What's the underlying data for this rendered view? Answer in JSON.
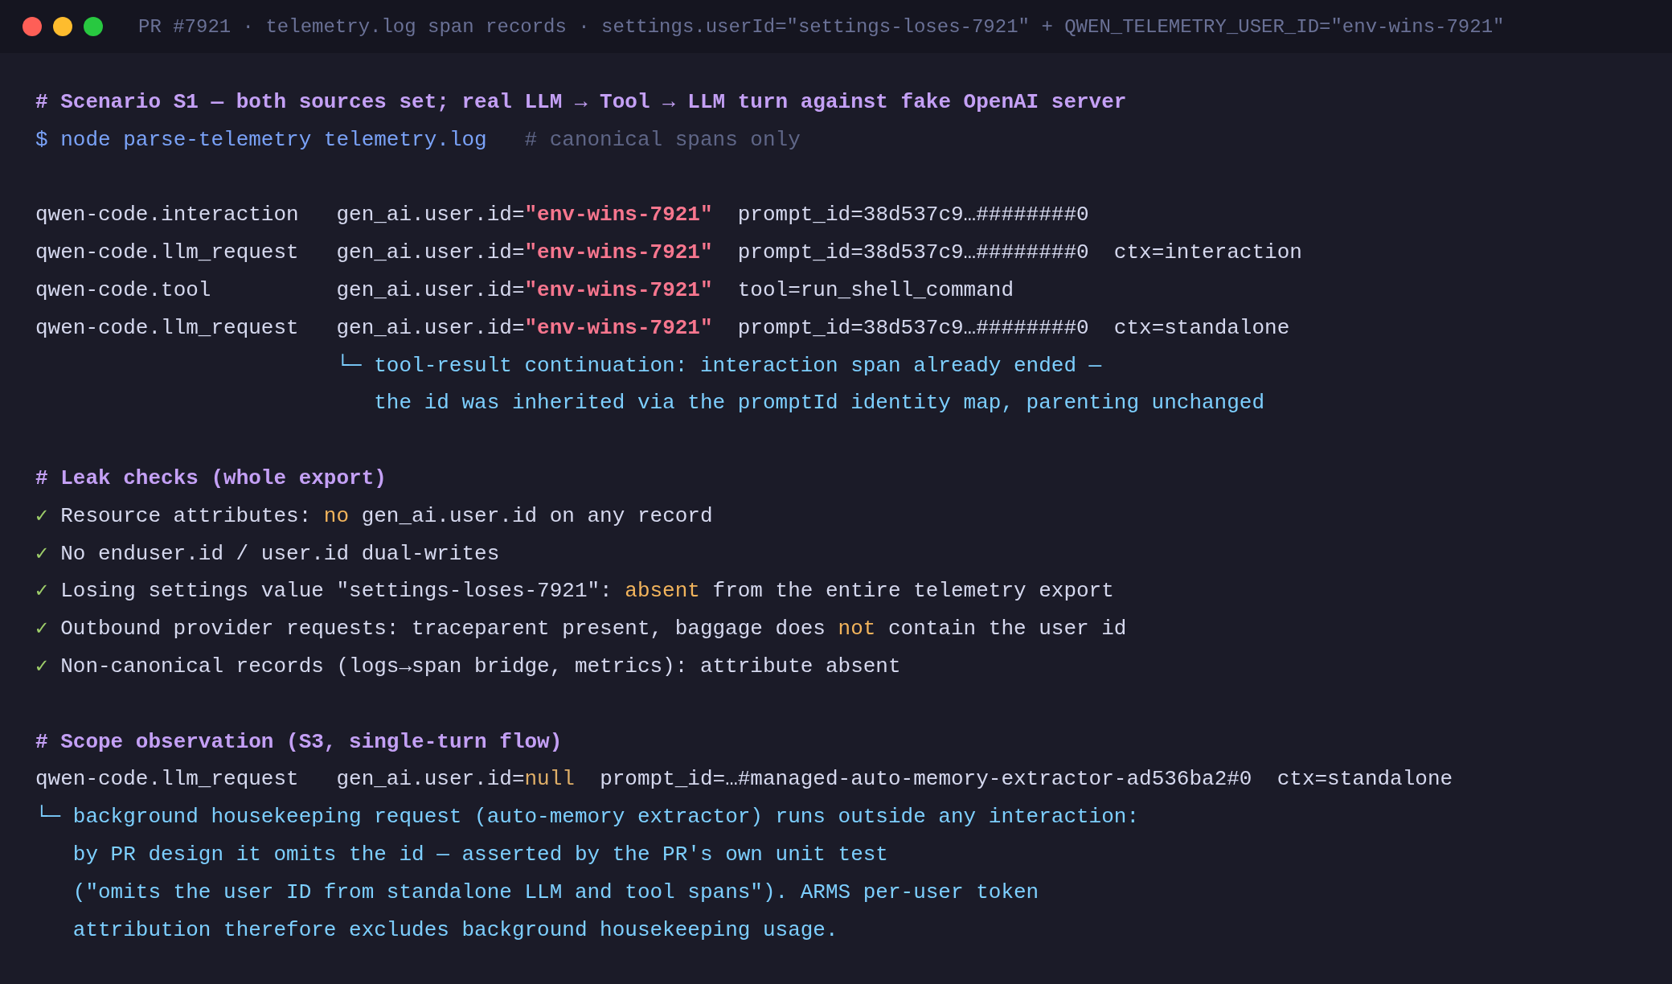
{
  "window": {
    "title": "PR #7921 · telemetry.log span records · settings.userId=\"settings-loses-7921\" + QWEN_TELEMETRY_USER_ID=\"env-wins-7921\""
  },
  "sections": [
    {
      "heading": "# Scenario S1 — both sources set; real LLM → Tool → LLM turn against fake OpenAI server",
      "command": {
        "prompt": "$ node parse-telemetry telemetry.log",
        "comment": "# canonical spans only"
      },
      "spans": [
        {
          "name": "qwen-code.interaction",
          "key": "gen_ai.user.id=",
          "value": {
            "text": "\"env-wins-7921\"",
            "kind": "string"
          },
          "detail": "prompt_id=38d537c9…########0"
        },
        {
          "name": "qwen-code.llm_request",
          "key": "gen_ai.user.id=",
          "value": {
            "text": "\"env-wins-7921\"",
            "kind": "string"
          },
          "detail": "prompt_id=38d537c9…########0",
          "ctx": "ctx=interaction"
        },
        {
          "name": "qwen-code.tool",
          "key": "gen_ai.user.id=",
          "value": {
            "text": "\"env-wins-7921\"",
            "kind": "string"
          },
          "detail": "tool=run_shell_command"
        },
        {
          "name": "qwen-code.llm_request",
          "key": "gen_ai.user.id=",
          "value": {
            "text": "\"env-wins-7921\"",
            "kind": "string"
          },
          "detail": "prompt_id=38d537c9…########0",
          "ctx": "ctx=standalone"
        }
      ],
      "note": {
        "kind": "nested",
        "branch": "└─",
        "lines": [
          "tool-result continuation: interaction span already ended —",
          "the id was inherited via the promptId identity map, parenting unchanged"
        ]
      }
    },
    {
      "heading": "# Leak checks (whole export)",
      "checks": [
        {
          "mark": "✓",
          "parts": [
            {
              "text": "Resource attributes: ",
              "kind": "plain"
            },
            {
              "text": "no",
              "kind": "warn"
            },
            {
              "text": " gen_ai.user.id on any record",
              "kind": "plain"
            }
          ]
        },
        {
          "mark": "✓",
          "parts": [
            {
              "text": "No enduser.id / user.id dual-writes",
              "kind": "plain"
            }
          ]
        },
        {
          "mark": "✓",
          "parts": [
            {
              "text": "Losing settings value \"settings-loses-7921\": ",
              "kind": "plain"
            },
            {
              "text": "absent",
              "kind": "warn"
            },
            {
              "text": " from the entire telemetry export",
              "kind": "plain"
            }
          ]
        },
        {
          "mark": "✓",
          "parts": [
            {
              "text": "Outbound provider requests: traceparent present, baggage does ",
              "kind": "plain"
            },
            {
              "text": "not",
              "kind": "warn"
            },
            {
              "text": " contain the user id",
              "kind": "plain"
            }
          ]
        },
        {
          "mark": "✓",
          "parts": [
            {
              "text": "Non-canonical records (logs→span bridge, metrics): attribute absent",
              "kind": "plain"
            }
          ]
        }
      ]
    },
    {
      "heading": "# Scope observation (S3, single-turn flow)",
      "spans": [
        {
          "name": "qwen-code.llm_request",
          "key": "gen_ai.user.id=",
          "value": {
            "text": "null",
            "kind": "null"
          },
          "detail": "prompt_id=…#managed-auto-memory-extractor-ad536ba2#0",
          "ctx": "ctx=standalone"
        }
      ],
      "note": {
        "kind": "top",
        "branch": "└─",
        "lines": [
          "background housekeeping request (auto-memory extractor) runs outside any interaction:",
          "by PR design it omits the id — asserted by the PR's own unit test",
          "(\"omits the user ID from standalone LLM and tool spans\"). ARMS per-user token",
          "attribution therefore excludes background housekeeping usage."
        ]
      }
    }
  ]
}
